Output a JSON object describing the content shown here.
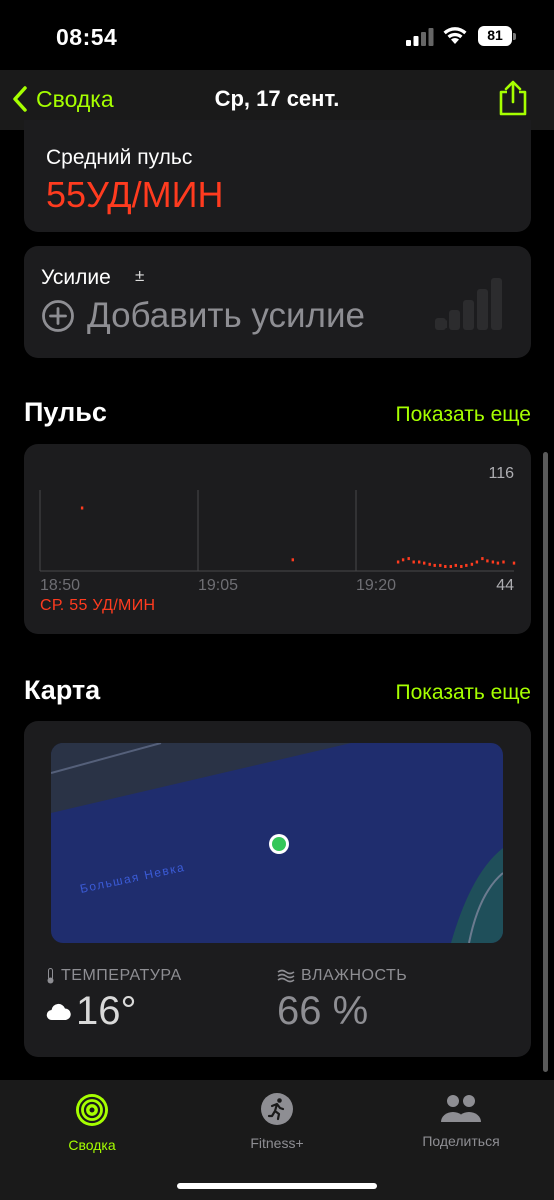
{
  "status_bar": {
    "time": "08:54",
    "battery": "81"
  },
  "nav": {
    "back_label": "Сводка",
    "title": "Ср, 17 сент."
  },
  "heart_rate_card": {
    "label": "Средний пульс",
    "value": "55УД/МИН"
  },
  "effort_card": {
    "label": "Усилие",
    "plus_minus": "±",
    "add_label": "Добавить усилие"
  },
  "pulse_section": {
    "title": "Пульс",
    "show_more": "Показать еще",
    "avg_label": "СР. 55 УД/МИН"
  },
  "chart_data": {
    "type": "scatter",
    "x_tick_labels": [
      "18:50",
      "19:05",
      "19:20"
    ],
    "y_max_label": "116",
    "y_min_label": "44",
    "ylim": [
      44,
      116
    ],
    "color": "#ff3b1f",
    "points": [
      {
        "t": "18:54",
        "y": 100
      },
      {
        "t": "19:14",
        "y": 54
      },
      {
        "t": "19:24",
        "y": 52
      },
      {
        "t": "19:24",
        "y": 54
      },
      {
        "t": "19:25",
        "y": 55
      },
      {
        "t": "19:25",
        "y": 52
      },
      {
        "t": "19:26",
        "y": 52
      },
      {
        "t": "19:26",
        "y": 51
      },
      {
        "t": "19:27",
        "y": 50
      },
      {
        "t": "19:27",
        "y": 49
      },
      {
        "t": "19:28",
        "y": 49
      },
      {
        "t": "19:28",
        "y": 48
      },
      {
        "t": "19:29",
        "y": 48
      },
      {
        "t": "19:29",
        "y": 49
      },
      {
        "t": "19:30",
        "y": 48
      },
      {
        "t": "19:30",
        "y": 49
      },
      {
        "t": "19:31",
        "y": 50
      },
      {
        "t": "19:31",
        "y": 52
      },
      {
        "t": "19:32",
        "y": 55
      },
      {
        "t": "19:32",
        "y": 53
      },
      {
        "t": "19:33",
        "y": 52
      },
      {
        "t": "19:33",
        "y": 51
      },
      {
        "t": "19:34",
        "y": 52
      },
      {
        "t": "19:35",
        "y": 51
      }
    ]
  },
  "map_section": {
    "title": "Карта",
    "show_more": "Показать еще",
    "map_label": "Большая Невка",
    "colors": {
      "water": "#1f2d6e",
      "land": "#2a3346",
      "park": "#1f4f5a",
      "dot": "#34c759"
    }
  },
  "weather": {
    "temp_label": "ТЕМПЕРАТУРА",
    "temp_value": "16°",
    "humidity_label": "ВЛАЖНОСТЬ",
    "humidity_value": "66 %"
  },
  "tabs": [
    {
      "label": "Сводка",
      "icon": "activity-rings-icon",
      "active": true
    },
    {
      "label": "Fitness+",
      "icon": "runner-icon",
      "active": false
    },
    {
      "label": "Поделиться",
      "icon": "people-icon",
      "active": false
    }
  ],
  "accent_color": "#a6ff00"
}
